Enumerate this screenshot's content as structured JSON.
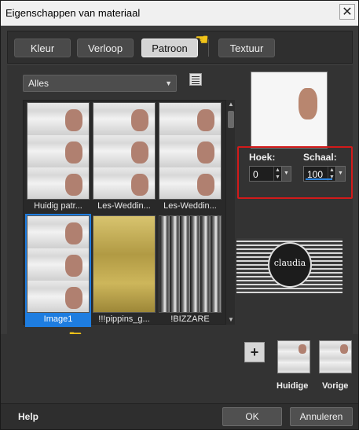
{
  "window": {
    "title": "Eigenschappen van materiaal"
  },
  "tabs": [
    {
      "label": "Kleur",
      "active": false
    },
    {
      "label": "Verloop",
      "active": false
    },
    {
      "label": "Patroon",
      "active": true
    },
    {
      "label": "Textuur",
      "active": false
    }
  ],
  "filter": {
    "selected": "Alles"
  },
  "patterns": [
    {
      "label": "Huidig patr...",
      "selected": false
    },
    {
      "label": "Les-Weddin...",
      "selected": false
    },
    {
      "label": "Les-Weddin...",
      "selected": false
    },
    {
      "label": "Image1",
      "selected": true
    },
    {
      "label": "!!!pippins_g...",
      "selected": false
    },
    {
      "label": "!BIZZARE",
      "selected": false
    }
  ],
  "params": {
    "angle_label": "Hoek:",
    "angle_value": "0",
    "scale_label": "Schaal:",
    "scale_value": "100"
  },
  "watermark": {
    "text": "claudia"
  },
  "recent": {
    "current_label": "Huidige",
    "previous_label": "Vorige"
  },
  "footer": {
    "help": "Help",
    "ok": "OK",
    "cancel": "Annuleren"
  },
  "colors": {
    "highlight": "#d21a1a",
    "selection": "#1e7de0",
    "pointer": "#f2c418"
  }
}
